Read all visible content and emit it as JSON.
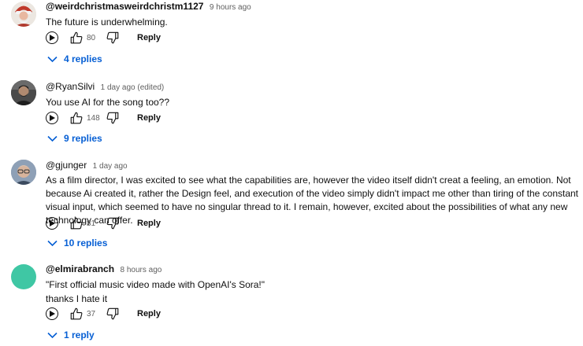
{
  "comments": [
    {
      "handle": "@weirdchristmasweirdchristm1127",
      "time": "9 hours ago",
      "text": [
        "The future is underwhelming."
      ],
      "likes": "80",
      "reply_label": "Reply",
      "replies_label": "4 replies",
      "avatar": "santa-photo"
    },
    {
      "handle": "@RyanSilvi",
      "time": "1 day ago (edited)",
      "text": [
        "You use AI for the song too??"
      ],
      "likes": "148",
      "reply_label": "Reply",
      "replies_label": "9 replies",
      "avatar": "man-dark-photo"
    },
    {
      "handle": "@gjunger",
      "time": "1 day ago",
      "text": [
        "As a film director, I was excited to see what the capabilities are, however the video itself didn't creat a feeling, an emotion. Not because Ai created it, rather the Design feel, and execution of the video simply didn't impact me other than tiring of the constant visual input, which seemed to have no singular thread to it. I remain, however, excited about the possibilities of what any new technology can offer."
      ],
      "likes": "81",
      "reply_label": "Reply",
      "replies_label": "10 replies",
      "avatar": "man-glasses-photo"
    },
    {
      "handle": "@elmirabranch",
      "time": "8 hours ago",
      "text": [
        "\"First official music video made with OpenAI's Sora!\"",
        "thanks I hate it"
      ],
      "likes": "37",
      "reply_label": "Reply",
      "replies_label": "1 reply",
      "avatar": "teal-circle",
      "avatar_color": "#3fc7a4"
    }
  ],
  "colors": {
    "link_blue": "#065fd4",
    "secondary_text": "#606060",
    "primary_text": "#0f0f0f"
  },
  "icons": [
    "play-icon",
    "thumb-up-icon",
    "thumb-down-icon",
    "chevron-down-icon"
  ]
}
